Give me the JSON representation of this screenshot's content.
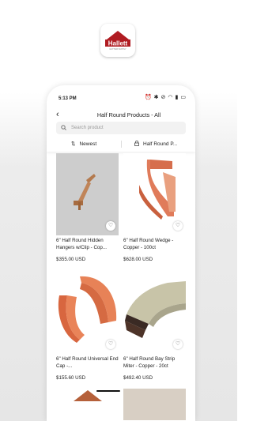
{
  "logo": {
    "text": "Hallett",
    "subtext": "GUTTER SUPPLY",
    "brand_color": "#b01c22"
  },
  "status_bar": {
    "time": "5:13 PM",
    "icons": [
      "alarm-icon",
      "bluetooth-icon",
      "mute-icon",
      "wifi-icon",
      "signal-icon",
      "battery-icon"
    ]
  },
  "header": {
    "back_icon": "back-arrow-icon",
    "title": "Half Round Products - All"
  },
  "search": {
    "placeholder": "Search product"
  },
  "filters": {
    "sort_label": "Newest",
    "category_label": "Half Round P..."
  },
  "products": [
    {
      "name": "6\" Half Round Hidden Hangers w/Clip - Cop...",
      "price": "$355.00 USD"
    },
    {
      "name": "6\" Half Round Wedge - Copper - 100ct",
      "price": "$628.00 USD"
    },
    {
      "name": "6\" Half Round Universal End Cap -...",
      "price": "$155.60 USD"
    },
    {
      "name": "6\" Half Round Bay Strip Miter - Copper - 20ct",
      "price": "$492.40 USD"
    }
  ]
}
